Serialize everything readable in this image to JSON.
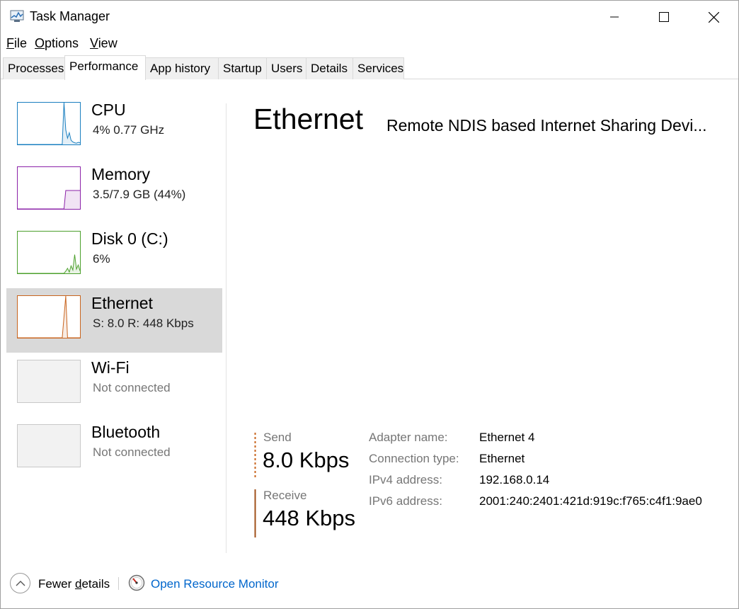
{
  "window": {
    "title": "Task Manager",
    "icon": "task-manager-icon"
  },
  "menu": [
    {
      "label": "File",
      "underline": "F",
      "rest": "ile"
    },
    {
      "label": "Options",
      "underline": "O",
      "rest": "ptions"
    },
    {
      "label": "View",
      "underline": "V",
      "rest": "iew"
    }
  ],
  "tabs": [
    {
      "label": "Processes"
    },
    {
      "label": "Performance",
      "active": true
    },
    {
      "label": "App history"
    },
    {
      "label": "Startup"
    },
    {
      "label": "Users"
    },
    {
      "label": "Details"
    },
    {
      "label": "Services"
    }
  ],
  "sidebar": {
    "items": [
      {
        "name": "CPU",
        "sub": "4%  0.77 GHz",
        "color": "#1a7fc0",
        "graph_values": [
          0,
          0,
          0,
          0,
          0,
          0,
          0,
          0,
          0,
          0,
          0,
          0,
          0,
          0,
          0,
          0,
          0,
          0,
          0,
          0,
          0,
          0,
          0,
          0,
          0,
          0,
          100,
          35,
          15,
          28,
          10,
          6,
          4,
          3,
          5,
          4
        ]
      },
      {
        "name": "Memory",
        "sub": "3.5/7.9 GB (44%)",
        "color": "#8b22a8",
        "graph_values": [
          0,
          0,
          0,
          0,
          0,
          0,
          0,
          0,
          0,
          0,
          0,
          0,
          0,
          0,
          0,
          0,
          0,
          0,
          0,
          0,
          0,
          0,
          0,
          0,
          0,
          0,
          0,
          44,
          44,
          44,
          44,
          44,
          44,
          44,
          44,
          44
        ]
      },
      {
        "name": "Disk 0 (C:)",
        "sub": "6%",
        "color": "#4ca02c",
        "graph_values": [
          0,
          0,
          0,
          0,
          0,
          0,
          0,
          0,
          0,
          0,
          0,
          0,
          0,
          0,
          0,
          0,
          0,
          0,
          0,
          0,
          0,
          0,
          0,
          0,
          0,
          0,
          0,
          5,
          12,
          3,
          18,
          8,
          45,
          10,
          20,
          6
        ]
      },
      {
        "name": "Ethernet",
        "sub": "S: 8.0  R: 448 Kbps",
        "color": "#c8641e",
        "selected": true,
        "graph_values": [
          0,
          0,
          0,
          0,
          0,
          0,
          0,
          0,
          0,
          0,
          0,
          0,
          0,
          0,
          0,
          0,
          0,
          0,
          0,
          0,
          0,
          0,
          0,
          0,
          0,
          0,
          50,
          100,
          0,
          0,
          0,
          0,
          0,
          0,
          0,
          0
        ]
      },
      {
        "name": "Wi-Fi",
        "sub": "Not connected",
        "color": "#c0c0c0",
        "disabled": true
      },
      {
        "name": "Bluetooth",
        "sub": "Not connected",
        "color": "#c0c0c0",
        "disabled": true
      }
    ]
  },
  "main": {
    "title": "Ethernet",
    "subtitle": "Remote NDIS based Internet Sharing Devi...",
    "send": {
      "label": "Send",
      "value": "8.0 Kbps",
      "bar_color": "#c8641e"
    },
    "receive": {
      "label": "Receive",
      "value": "448 Kbps",
      "bar_color": "#a0501a"
    },
    "properties": [
      {
        "label": "Adapter name:",
        "value": "Ethernet 4"
      },
      {
        "label": "Connection type:",
        "value": "Ethernet"
      },
      {
        "label": "IPv4 address:",
        "value": "192.168.0.14"
      },
      {
        "label": "IPv6 address:",
        "value": "2001:240:2401:421d:919c:f765:c4f1:9ae0"
      }
    ]
  },
  "footer": {
    "fewer_details_prefix": "Fewer ",
    "fewer_details_underlined": "d",
    "fewer_details_suffix": "etails",
    "resource_monitor_link": "Open Resource Monitor",
    "link_color": "#0066cc"
  }
}
